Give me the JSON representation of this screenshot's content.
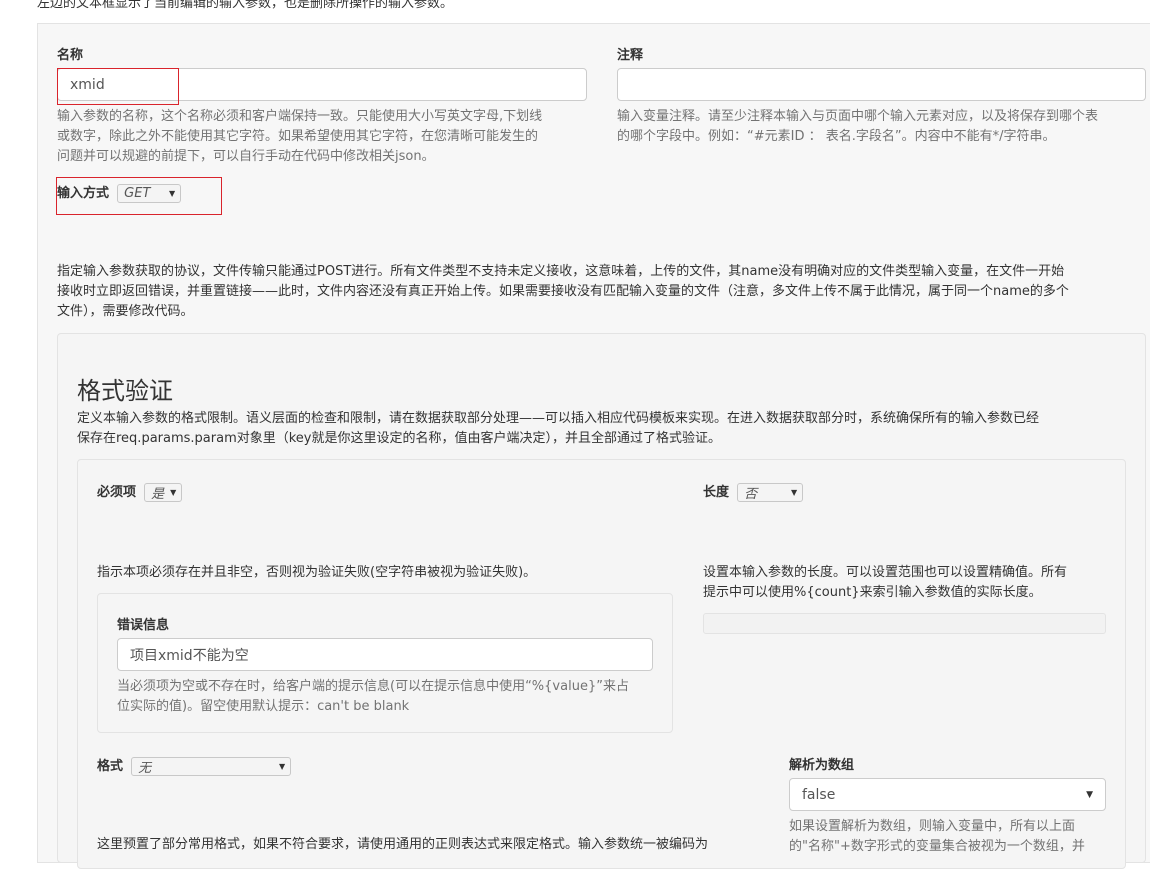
{
  "intro": "左边的文本框显示了当前编辑的输入参数，也是删除所操作的输入参数。",
  "name_field": {
    "label": "名称",
    "value": "xmid",
    "help": [
      "输入参数的名称，这个名称必须和客户端保持一致。只能使用大小写英文字母,下划线",
      "或数字，除此之外不能使用其它字符。如果希望使用其它字符，在您清晰可能发生的",
      "问题并可以规避的前提下，可以自行手动在代码中修改相关json。"
    ]
  },
  "comment_field": {
    "label": "注释",
    "value": "",
    "help": [
      "输入变量注释。请至少注释本输入与页面中哪个输入元素对应，以及将保存到哪个表",
      "的哪个字段中。例如：“#元素ID ： 表名.字段名”。内容中不能有*/字符串。"
    ]
  },
  "input_method": {
    "label": "输入方式",
    "selected": "GET",
    "help": [
      "指定输入参数获取的协议，文件传输只能通过POST进行。所有文件类型不支持未定义接收，这意味着，上传的文件，其name没有明确对应的文件类型输入变量，在文件一开始",
      "接收时立即返回错误，并重置链接——此时，文件内容还没有真正开始上传。如果需要接收没有匹配输入变量的文件（注意，多文件上传不属于此情况，属于同一个name的多个",
      "文件），需要修改代码。"
    ]
  },
  "format_validation": {
    "title": "格式验证",
    "desc": [
      "定义本输入参数的格式限制。语义层面的检查和限制，请在数据获取部分处理——可以插入相应代码模板来实现。在进入数据获取部分时，系统确保所有的输入参数已经",
      "保存在req.params.param对象里（key就是你这里设定的名称，值由客户端决定），并且全部通过了格式验证。"
    ],
    "required": {
      "label": "必须项",
      "selected": "是",
      "desc": "指示本项必须存在并且非空，否则视为验证失败(空字符串被视为验证失败)。"
    },
    "error_message": {
      "label": "错误信息",
      "value": "项目xmid不能为空",
      "help": [
        "当必须项为空或不存在时，给客户端的提示信息(可以在提示信息中使用“%{value}”来占",
        "位实际的值)。留空使用默认提示：can't be blank"
      ]
    },
    "length": {
      "label": "长度",
      "selected": "否",
      "desc": [
        "设置本输入参数的长度。可以设置范围也可以设置精确值。所有",
        "提示中可以使用%{count}来索引输入参数值的实际长度。"
      ]
    },
    "format": {
      "label": "格式",
      "selected": "无",
      "desc": "这里预置了部分常用格式，如果不符合要求，请使用通用的正则表达式来限定格式。输入参数统一被编码为"
    },
    "parse_array": {
      "label": "解析为数组",
      "selected": "false",
      "help": [
        "如果设置解析为数组，则输入变量中，所有以上面",
        "的\"名称\"+数字形式的变量集合被视为一个数组，并"
      ]
    }
  },
  "colors": {
    "highlight_border": "#d9242c",
    "panel_bg": "#f7f7f7"
  }
}
